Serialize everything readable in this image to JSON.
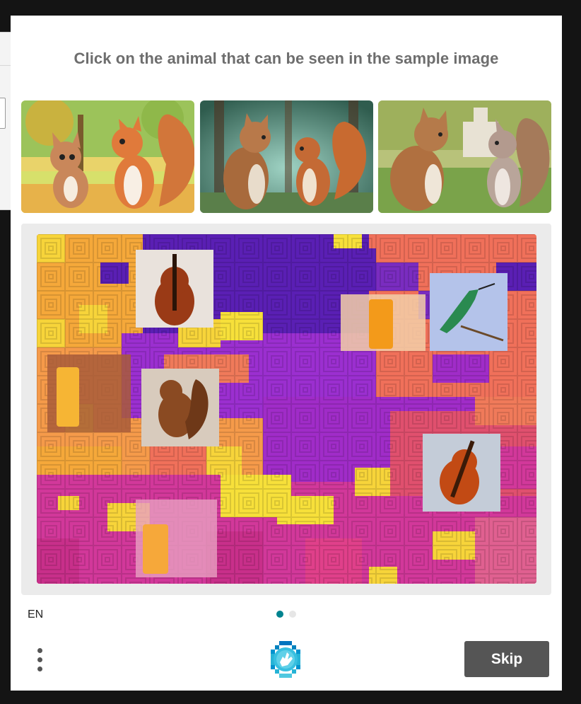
{
  "challenge": {
    "prompt": "Click on the animal that can be seen in the sample image",
    "samples": [
      {
        "name": "sample-cartoon-cat-squirrel"
      },
      {
        "name": "sample-painted-cat-squirrel-forest"
      },
      {
        "name": "sample-painted-cat-squirrel-park"
      }
    ],
    "grid_objects": [
      "violin",
      "drink-glass",
      "hummingbird",
      "squirrel",
      "violin",
      "drink-glass",
      "drink-glass"
    ]
  },
  "footer": {
    "language": "EN",
    "pagination": {
      "total": 2,
      "current": 1
    },
    "skip_label": "Skip",
    "menu_icon": "vertical-ellipsis-icon",
    "logo_icon": "hcaptcha-hand-logo-icon"
  },
  "colors": {
    "accent": "#00838f",
    "dot_inactive": "#e6e6e6",
    "button": "#555555",
    "prompt_text": "#6e6e6e"
  }
}
